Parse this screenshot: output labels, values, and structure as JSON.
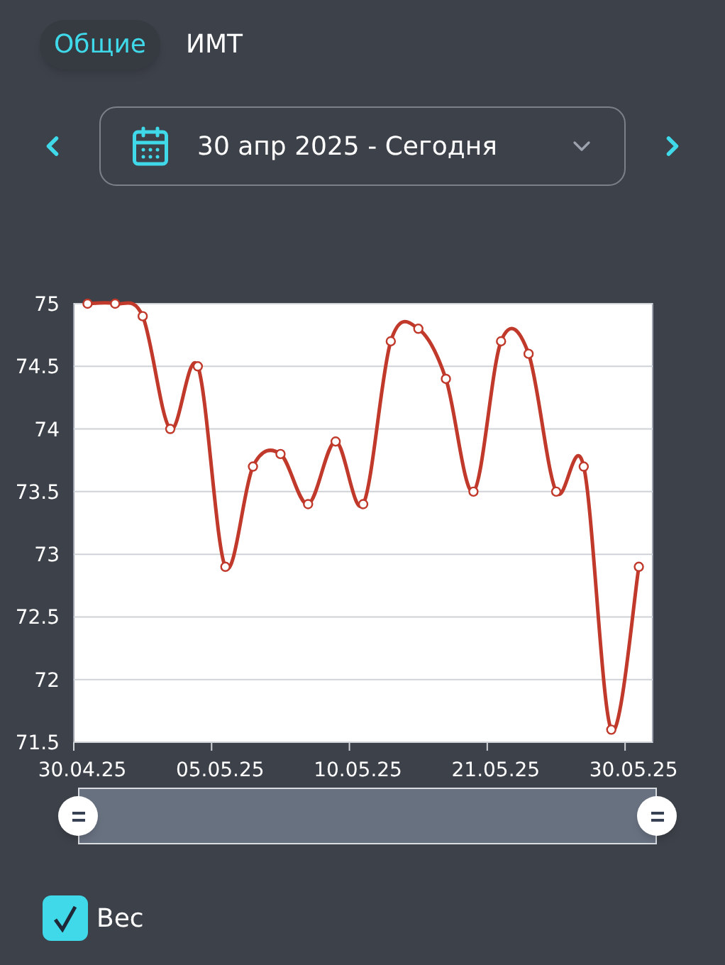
{
  "tabs": [
    {
      "label": "Общие",
      "selected": true
    },
    {
      "label": "ИМТ",
      "selected": false
    }
  ],
  "date_range": {
    "label": "30 апр 2025 - Сегодня"
  },
  "chart": {
    "chart_data": {
      "type": "line",
      "categories": [
        "30.04.25",
        null,
        null,
        null,
        null,
        "05.05.25",
        null,
        null,
        null,
        null,
        "10.05.25",
        null,
        null,
        null,
        null,
        "21.05.25",
        null,
        null,
        null,
        null,
        "30.05.25"
      ],
      "ylim": [
        71.5,
        75
      ],
      "grid": true,
      "series": [
        {
          "name": "Вес",
          "color": "#c0392b",
          "marker": "circle",
          "values": [
            75,
            75,
            74.9,
            74.0,
            74.5,
            72.9,
            73.7,
            73.8,
            73.4,
            73.9,
            73.4,
            74.7,
            74.8,
            74.4,
            73.5,
            74.7,
            74.6,
            73.5,
            73.7,
            71.6,
            72.9
          ]
        }
      ],
      "yticks": [
        {
          "value": 71.5,
          "label": "71.5"
        },
        {
          "value": 72,
          "label": "72"
        },
        {
          "value": 72.5,
          "label": "72.5"
        },
        {
          "value": 73,
          "label": "73"
        },
        {
          "value": 73.5,
          "label": "73.5"
        },
        {
          "value": 74,
          "label": "74"
        },
        {
          "value": 74.5,
          "label": "74.5"
        },
        {
          "value": 75,
          "label": "75"
        }
      ]
    }
  },
  "legend": [
    {
      "checked": true
    }
  ]
}
